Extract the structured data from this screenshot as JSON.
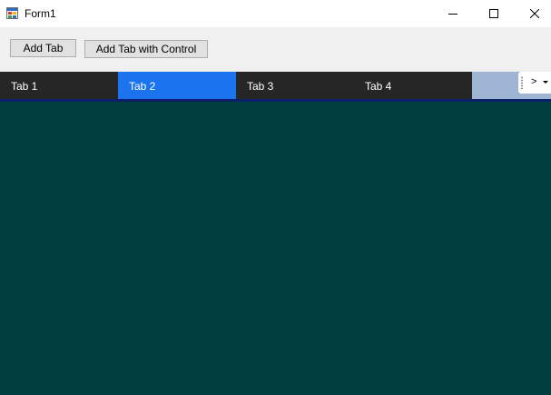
{
  "window": {
    "title": "Form1",
    "icon": "winforms-app-icon",
    "controls": {
      "minimize_icon": "minimize-icon",
      "maximize_icon": "maximize-icon",
      "close_icon": "close-icon"
    }
  },
  "toolbar": {
    "add_tab_label": "Add Tab",
    "add_tab_control_label": "Add Tab with Control"
  },
  "tabs": [
    {
      "label": "Tab 1",
      "active": false
    },
    {
      "label": "Tab 2",
      "active": true
    },
    {
      "label": "Tab 3",
      "active": false
    },
    {
      "label": "Tab 4",
      "active": false
    }
  ],
  "overflow": {
    "label": ">",
    "icon": "dropdown-arrow-icon"
  },
  "colors": {
    "tab_inactive": "#262626",
    "tab_active": "#1b74ee",
    "tabstrip_background": "#9db4d2",
    "tab_underline": "#0b1f6b",
    "content_background": "#003e3f"
  }
}
